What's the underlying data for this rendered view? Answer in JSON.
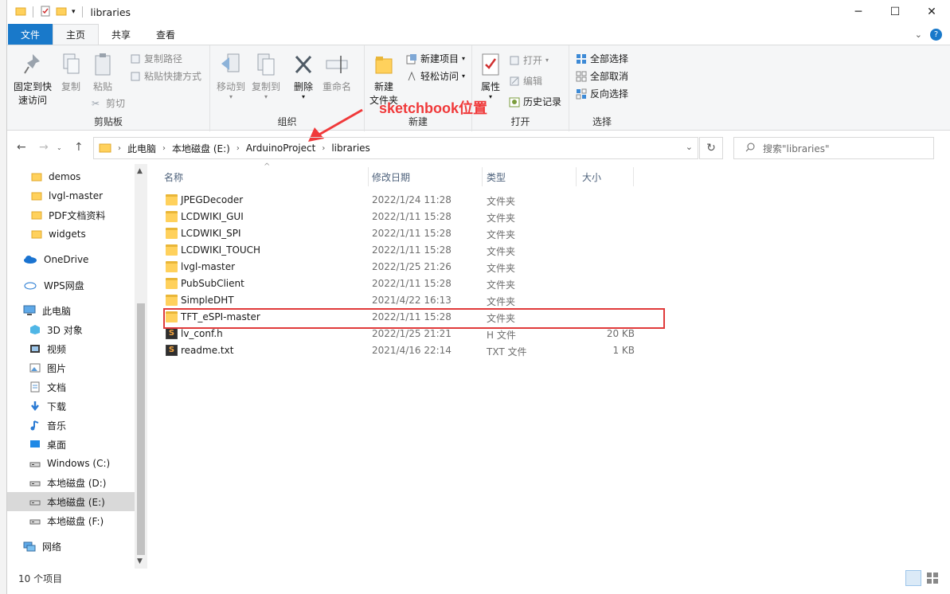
{
  "window": {
    "title": "libraries"
  },
  "tabs": {
    "file": "文件",
    "home": "主页",
    "share": "共享",
    "view": "查看"
  },
  "ribbon": {
    "clipboard": {
      "label": "剪贴板",
      "pin": "固定到快\n速访问",
      "pin_line1": "固定到快",
      "pin_line2": "速访问",
      "copy": "复制",
      "paste": "粘贴",
      "copy_path": "复制路径",
      "paste_shortcut": "粘贴快捷方式",
      "cut": "剪切"
    },
    "organize": {
      "label": "组织",
      "move_to": "移动到",
      "copy_to": "复制到",
      "delete": "删除",
      "rename": "重命名"
    },
    "new": {
      "label": "新建",
      "new_folder_line1": "新建",
      "new_folder_line2": "文件夹",
      "new_item": "新建项目",
      "easy_access": "轻松访问"
    },
    "open": {
      "label": "打开",
      "properties": "属性",
      "open": "打开",
      "edit": "编辑",
      "history": "历史记录"
    },
    "select": {
      "label": "选择",
      "select_all": "全部选择",
      "select_none": "全部取消",
      "invert": "反向选择"
    }
  },
  "address": {
    "crumbs": [
      "此电脑",
      "本地磁盘 (E:)",
      "ArduinoProject",
      "libraries"
    ]
  },
  "search": {
    "placeholder": "搜索\"libraries\""
  },
  "annotation": {
    "text": "sketchbook位置",
    "color": "#f0393a"
  },
  "nav": {
    "items": [
      {
        "label": "demos",
        "icon": "folder-icon"
      },
      {
        "label": "lvgl-master",
        "icon": "folder-icon"
      },
      {
        "label": "PDF文档资料",
        "icon": "folder-icon"
      },
      {
        "label": "widgets",
        "icon": "folder-icon"
      },
      {
        "label": "OneDrive",
        "icon": "cloud-icon"
      },
      {
        "label": "WPS网盘",
        "icon": "cloud-outline-icon"
      },
      {
        "label": "此电脑",
        "icon": "computer-icon"
      },
      {
        "label": "3D 对象",
        "icon": "cube-icon"
      },
      {
        "label": "视频",
        "icon": "video-icon"
      },
      {
        "label": "图片",
        "icon": "picture-icon"
      },
      {
        "label": "文档",
        "icon": "document-icon"
      },
      {
        "label": "下载",
        "icon": "download-icon"
      },
      {
        "label": "音乐",
        "icon": "music-icon"
      },
      {
        "label": "桌面",
        "icon": "desktop-icon"
      },
      {
        "label": "Windows (C:)",
        "icon": "drive-icon"
      },
      {
        "label": "本地磁盘 (D:)",
        "icon": "drive-icon"
      },
      {
        "label": "本地磁盘 (E:)",
        "icon": "drive-icon"
      },
      {
        "label": "本地磁盘 (F:)",
        "icon": "drive-icon"
      },
      {
        "label": "网络",
        "icon": "network-icon"
      }
    ]
  },
  "columns": {
    "name": "名称",
    "modified": "修改日期",
    "type": "类型",
    "size": "大小"
  },
  "files": [
    {
      "name": "JPEGDecoder",
      "modified": "2022/1/24 11:28",
      "type": "文件夹",
      "size": "",
      "icon": "folder-icon"
    },
    {
      "name": "LCDWIKI_GUI",
      "modified": "2022/1/11 15:28",
      "type": "文件夹",
      "size": "",
      "icon": "folder-icon"
    },
    {
      "name": "LCDWIKI_SPI",
      "modified": "2022/1/11 15:28",
      "type": "文件夹",
      "size": "",
      "icon": "folder-icon"
    },
    {
      "name": "LCDWIKI_TOUCH",
      "modified": "2022/1/11 15:28",
      "type": "文件夹",
      "size": "",
      "icon": "folder-icon"
    },
    {
      "name": "lvgl-master",
      "modified": "2022/1/25 21:26",
      "type": "文件夹",
      "size": "",
      "icon": "folder-icon"
    },
    {
      "name": "PubSubClient",
      "modified": "2022/1/11 15:28",
      "type": "文件夹",
      "size": "",
      "icon": "folder-icon"
    },
    {
      "name": "SimpleDHT",
      "modified": "2021/4/22 16:13",
      "type": "文件夹",
      "size": "",
      "icon": "folder-icon"
    },
    {
      "name": "TFT_eSPI-master",
      "modified": "2022/1/11 15:28",
      "type": "文件夹",
      "size": "",
      "icon": "folder-icon"
    },
    {
      "name": "lv_conf.h",
      "modified": "2022/1/25 21:21",
      "type": "H 文件",
      "size": "20 KB",
      "icon": "sublime-file-icon"
    },
    {
      "name": "readme.txt",
      "modified": "2021/4/16 22:14",
      "type": "TXT 文件",
      "size": "1 KB",
      "icon": "sublime-file-icon"
    }
  ],
  "status": {
    "count": "10 个项目"
  }
}
